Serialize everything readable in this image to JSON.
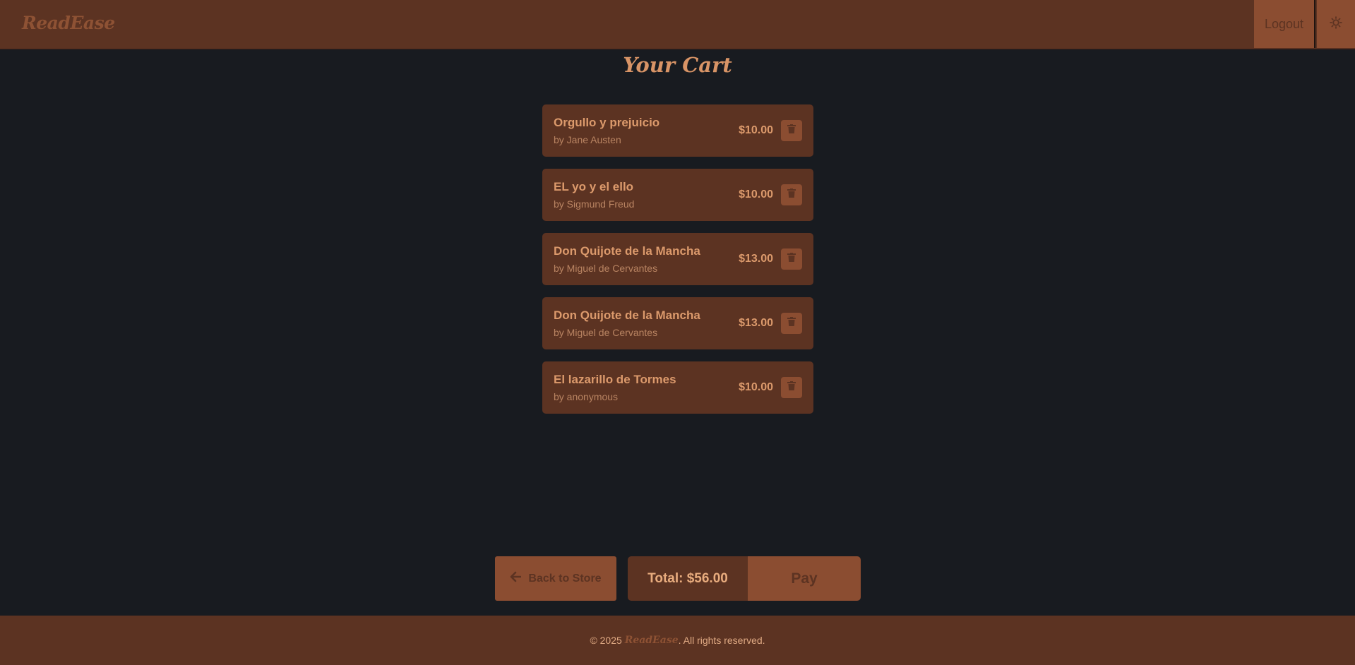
{
  "header": {
    "logo": "ReadEase",
    "logout_label": "Logout",
    "theme_icon": "sun-icon"
  },
  "page": {
    "title": "Your Cart"
  },
  "cart": {
    "items": [
      {
        "title": "Orgullo y prejuicio",
        "author": "by Jane Austen",
        "price": "$10.00"
      },
      {
        "title": "EL yo y el ello",
        "author": "by Sigmund Freud",
        "price": "$10.00"
      },
      {
        "title": "Don Quijote de la Mancha",
        "author": "by Miguel de Cervantes",
        "price": "$13.00"
      },
      {
        "title": "Don Quijote de la Mancha",
        "author": "by Miguel de Cervantes",
        "price": "$13.00"
      },
      {
        "title": "El lazarillo de Tormes",
        "author": "by anonymous",
        "price": "$10.00"
      }
    ],
    "delete_icon": "trash-icon"
  },
  "actions": {
    "back_label": "Back to Store",
    "back_icon": "arrow-left-icon",
    "total_label": "Total: $56.00",
    "pay_label": "Pay"
  },
  "footer": {
    "copyright_prefix": "© 2025",
    "brand": "ReadEase",
    "suffix": ". All rights reserved."
  },
  "colors": {
    "background": "#181b20",
    "header_bg": "#5c3322",
    "accent": "#8b4d31",
    "text_accent": "#dc9a6c"
  }
}
